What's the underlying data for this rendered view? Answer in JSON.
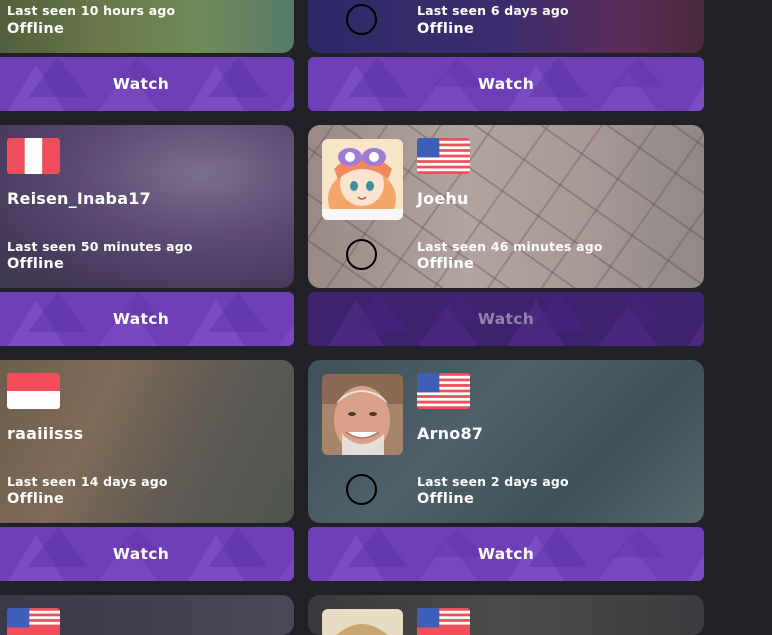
{
  "colors": {
    "page_background": "#212027",
    "watch_button": "#6f3fb8",
    "watch_button_disabled": "#3e2270"
  },
  "cards": [
    {
      "username": "",
      "flag": "",
      "avatar": "none",
      "last_seen": "Last seen 10 hours ago",
      "status": "Offline",
      "watch_label": "Watch",
      "watch_enabled": true
    },
    {
      "username": "",
      "flag": "",
      "avatar": "empty",
      "last_seen": "Last seen 6 days ago",
      "status": "Offline",
      "watch_label": "Watch",
      "watch_enabled": true
    },
    {
      "username": "Reisen_Inaba17",
      "flag": "peru-flag",
      "avatar": "none",
      "last_seen": "Last seen 50 minutes ago",
      "status": "Offline",
      "watch_label": "Watch",
      "watch_enabled": true
    },
    {
      "username": "Joehu",
      "flag": "usa-flag",
      "avatar": "anime-girl-avatar",
      "last_seen": "Last seen 46 minutes ago",
      "status": "Offline",
      "watch_label": "Watch",
      "watch_enabled": false
    },
    {
      "username": "raaiiisss",
      "flag": "indonesia-flag",
      "avatar": "none",
      "last_seen": "Last seen 14 days ago",
      "status": "Offline",
      "watch_label": "Watch",
      "watch_enabled": true
    },
    {
      "username": "Arno87",
      "flag": "usa-flag",
      "avatar": "smiling-man-avatar",
      "last_seen": "Last seen 2 days ago",
      "status": "Offline",
      "watch_label": "Watch",
      "watch_enabled": true
    }
  ]
}
